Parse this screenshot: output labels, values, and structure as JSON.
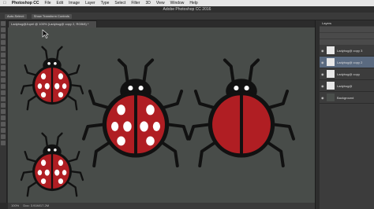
{
  "menubar": {
    "apple": "",
    "items": [
      "Photoshop CC",
      "File",
      "Edit",
      "Image",
      "Layer",
      "Type",
      "Select",
      "Filter",
      "3D",
      "View",
      "Window",
      "Help"
    ]
  },
  "window": {
    "title": "Adobe Photoshop CC 2016"
  },
  "options_bar": {
    "auto_select": "Auto-Select:",
    "show_transform": "Show Transform Controls"
  },
  "document": {
    "tab": "Ladybug@Jupel @ 100% (Ladybug@ copy 2, RGB/8) *"
  },
  "status": {
    "zoom": "100%",
    "doc": "Doc: 3.91M/17.2M"
  },
  "layers_panel": {
    "title": "Layers",
    "layers": [
      {
        "name": "Ladybug@ copy 3",
        "selected": false
      },
      {
        "name": "Ladybug@ copy 2",
        "selected": true
      },
      {
        "name": "Ladybug@ copy",
        "selected": false
      },
      {
        "name": "Ladybug@",
        "selected": false
      },
      {
        "name": "Background",
        "selected": false
      }
    ]
  },
  "colors": {
    "canvas": "#484c49",
    "ladybug_red": "#b01e23",
    "ladybug_black": "#111111",
    "selected_layer": "#5a6a80"
  }
}
